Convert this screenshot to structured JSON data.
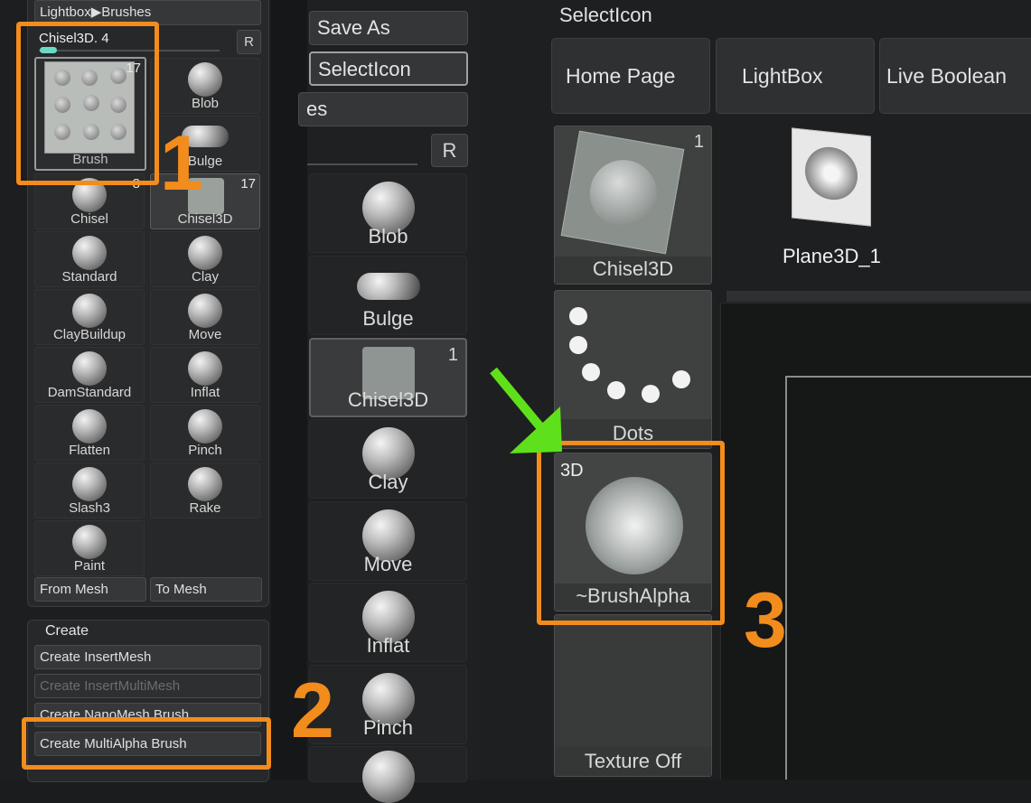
{
  "left_panel": {
    "path_button": "Lightbox▶Brushes",
    "current_brush": "Chisel3D. 4",
    "r_button": "R",
    "current_thumb_label": "Brush",
    "current_thumb_count": "17",
    "brushes": [
      {
        "label": "Blob",
        "count": ""
      },
      {
        "label": "Bulge",
        "count": ""
      },
      {
        "label": "Chisel",
        "count": "8"
      },
      {
        "label": "Chisel3D",
        "count": "17"
      },
      {
        "label": "Standard",
        "count": ""
      },
      {
        "label": "Clay",
        "count": ""
      },
      {
        "label": "ClayBuildup",
        "count": ""
      },
      {
        "label": "Move",
        "count": ""
      },
      {
        "label": "DamStandard",
        "count": ""
      },
      {
        "label": "Inflat",
        "count": ""
      },
      {
        "label": "Flatten",
        "count": ""
      },
      {
        "label": "Pinch",
        "count": ""
      },
      {
        "label": "Slash3",
        "count": ""
      },
      {
        "label": "Rake",
        "count": ""
      },
      {
        "label": "Paint",
        "count": ""
      }
    ],
    "from_mesh": "From Mesh",
    "to_mesh": "To Mesh",
    "create": {
      "title": "Create",
      "insert_mesh": "Create InsertMesh",
      "insert_multi_mesh": "Create InsertMultiMesh",
      "nanomesh": "Create NanoMesh Brush",
      "multialpha": "Create MultiAlpha Brush"
    }
  },
  "middle_panel": {
    "save_as": "Save As",
    "select_icon": "SelectIcon",
    "partial_btn": "es",
    "r_button": "R",
    "items": [
      {
        "label": "Blob",
        "count": ""
      },
      {
        "label": "Bulge",
        "count": ""
      },
      {
        "label": "Chisel3D",
        "count": "1"
      },
      {
        "label": "Clay",
        "count": ""
      },
      {
        "label": "Move",
        "count": ""
      },
      {
        "label": "Inflat",
        "count": ""
      },
      {
        "label": "Pinch",
        "count": ""
      }
    ]
  },
  "right_panel": {
    "section_title": "SelectIcon",
    "buttons": [
      "Home Page",
      "LightBox",
      "Live Boolean"
    ],
    "chisel_tile": {
      "label": "Chisel3D",
      "count": "1"
    },
    "plane_label": "Plane3D_1",
    "dots_label": "Dots",
    "alpha_tile": {
      "badge": "3D",
      "label": "~BrushAlpha"
    },
    "texture_label": "Texture Off"
  },
  "callouts": {
    "one": "1",
    "two": "2",
    "three": "3"
  },
  "colors": {
    "accent": "#f28c1c",
    "arrow": "#5ee01b",
    "slider": "#6cd9c4"
  }
}
